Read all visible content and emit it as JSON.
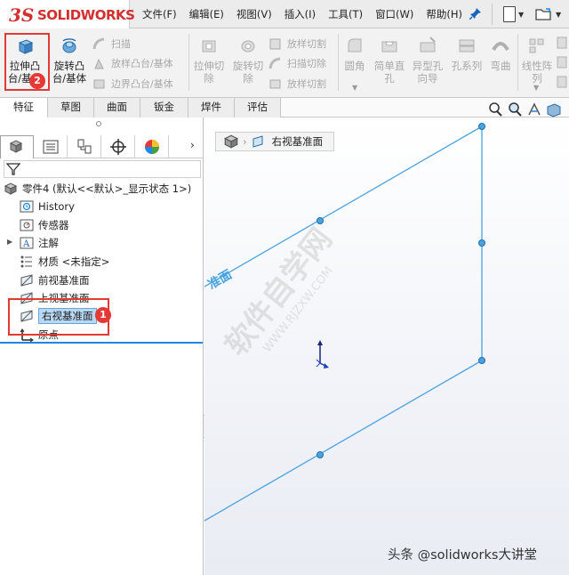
{
  "app": {
    "logo_mark": "3S",
    "logo_text": "SOLIDWORKS"
  },
  "menu": [
    "文件(F)",
    "编辑(E)",
    "视图(V)",
    "插入(I)",
    "工具(T)",
    "窗口(W)",
    "帮助(H)"
  ],
  "ribbon": {
    "extrude_boss": "拉伸凸\n台/基体",
    "revolve_boss": "旋转凸\n台/基体",
    "sweep": "扫描",
    "loft_boss": "放样凸台/基体",
    "boundary_boss": "边界凸台/基体",
    "extrude_cut": "拉伸切\n除",
    "revolve_cut": "旋转切\n除",
    "loft_cut": "放样切割",
    "sweep_cut": "扫描切除",
    "boundary_cut": "放样切割",
    "fillet": "圆角",
    "simple_hole": "简单直\n孔",
    "hole_wizard": "异型孔\n向导",
    "hole_series": "孔系列",
    "flex": "弯曲",
    "linear_pattern": "线性阵\n列"
  },
  "tabs": [
    "特征",
    "草图",
    "曲面",
    "钣金",
    "焊件",
    "评估"
  ],
  "tree": {
    "part": "零件4 (默认<<默认>_显示状态 1>)",
    "items": [
      "History",
      "传感器",
      "注解",
      "材质 <未指定>",
      "前视基准面",
      "上视基准面",
      "右视基准面",
      "原点"
    ]
  },
  "badges": {
    "one": "1",
    "two": "2"
  },
  "viewport": {
    "breadcrumb": "右视基准面",
    "plane_label": "准面",
    "watermark_cn": "软件自学网",
    "watermark_en": "WWW.RJZXW.COM",
    "credit": "头条 @solidworks大讲堂"
  },
  "colors": {
    "accent": "#1e88e5",
    "highlight": "#e53935",
    "plane_line": "#4aa3e0"
  }
}
